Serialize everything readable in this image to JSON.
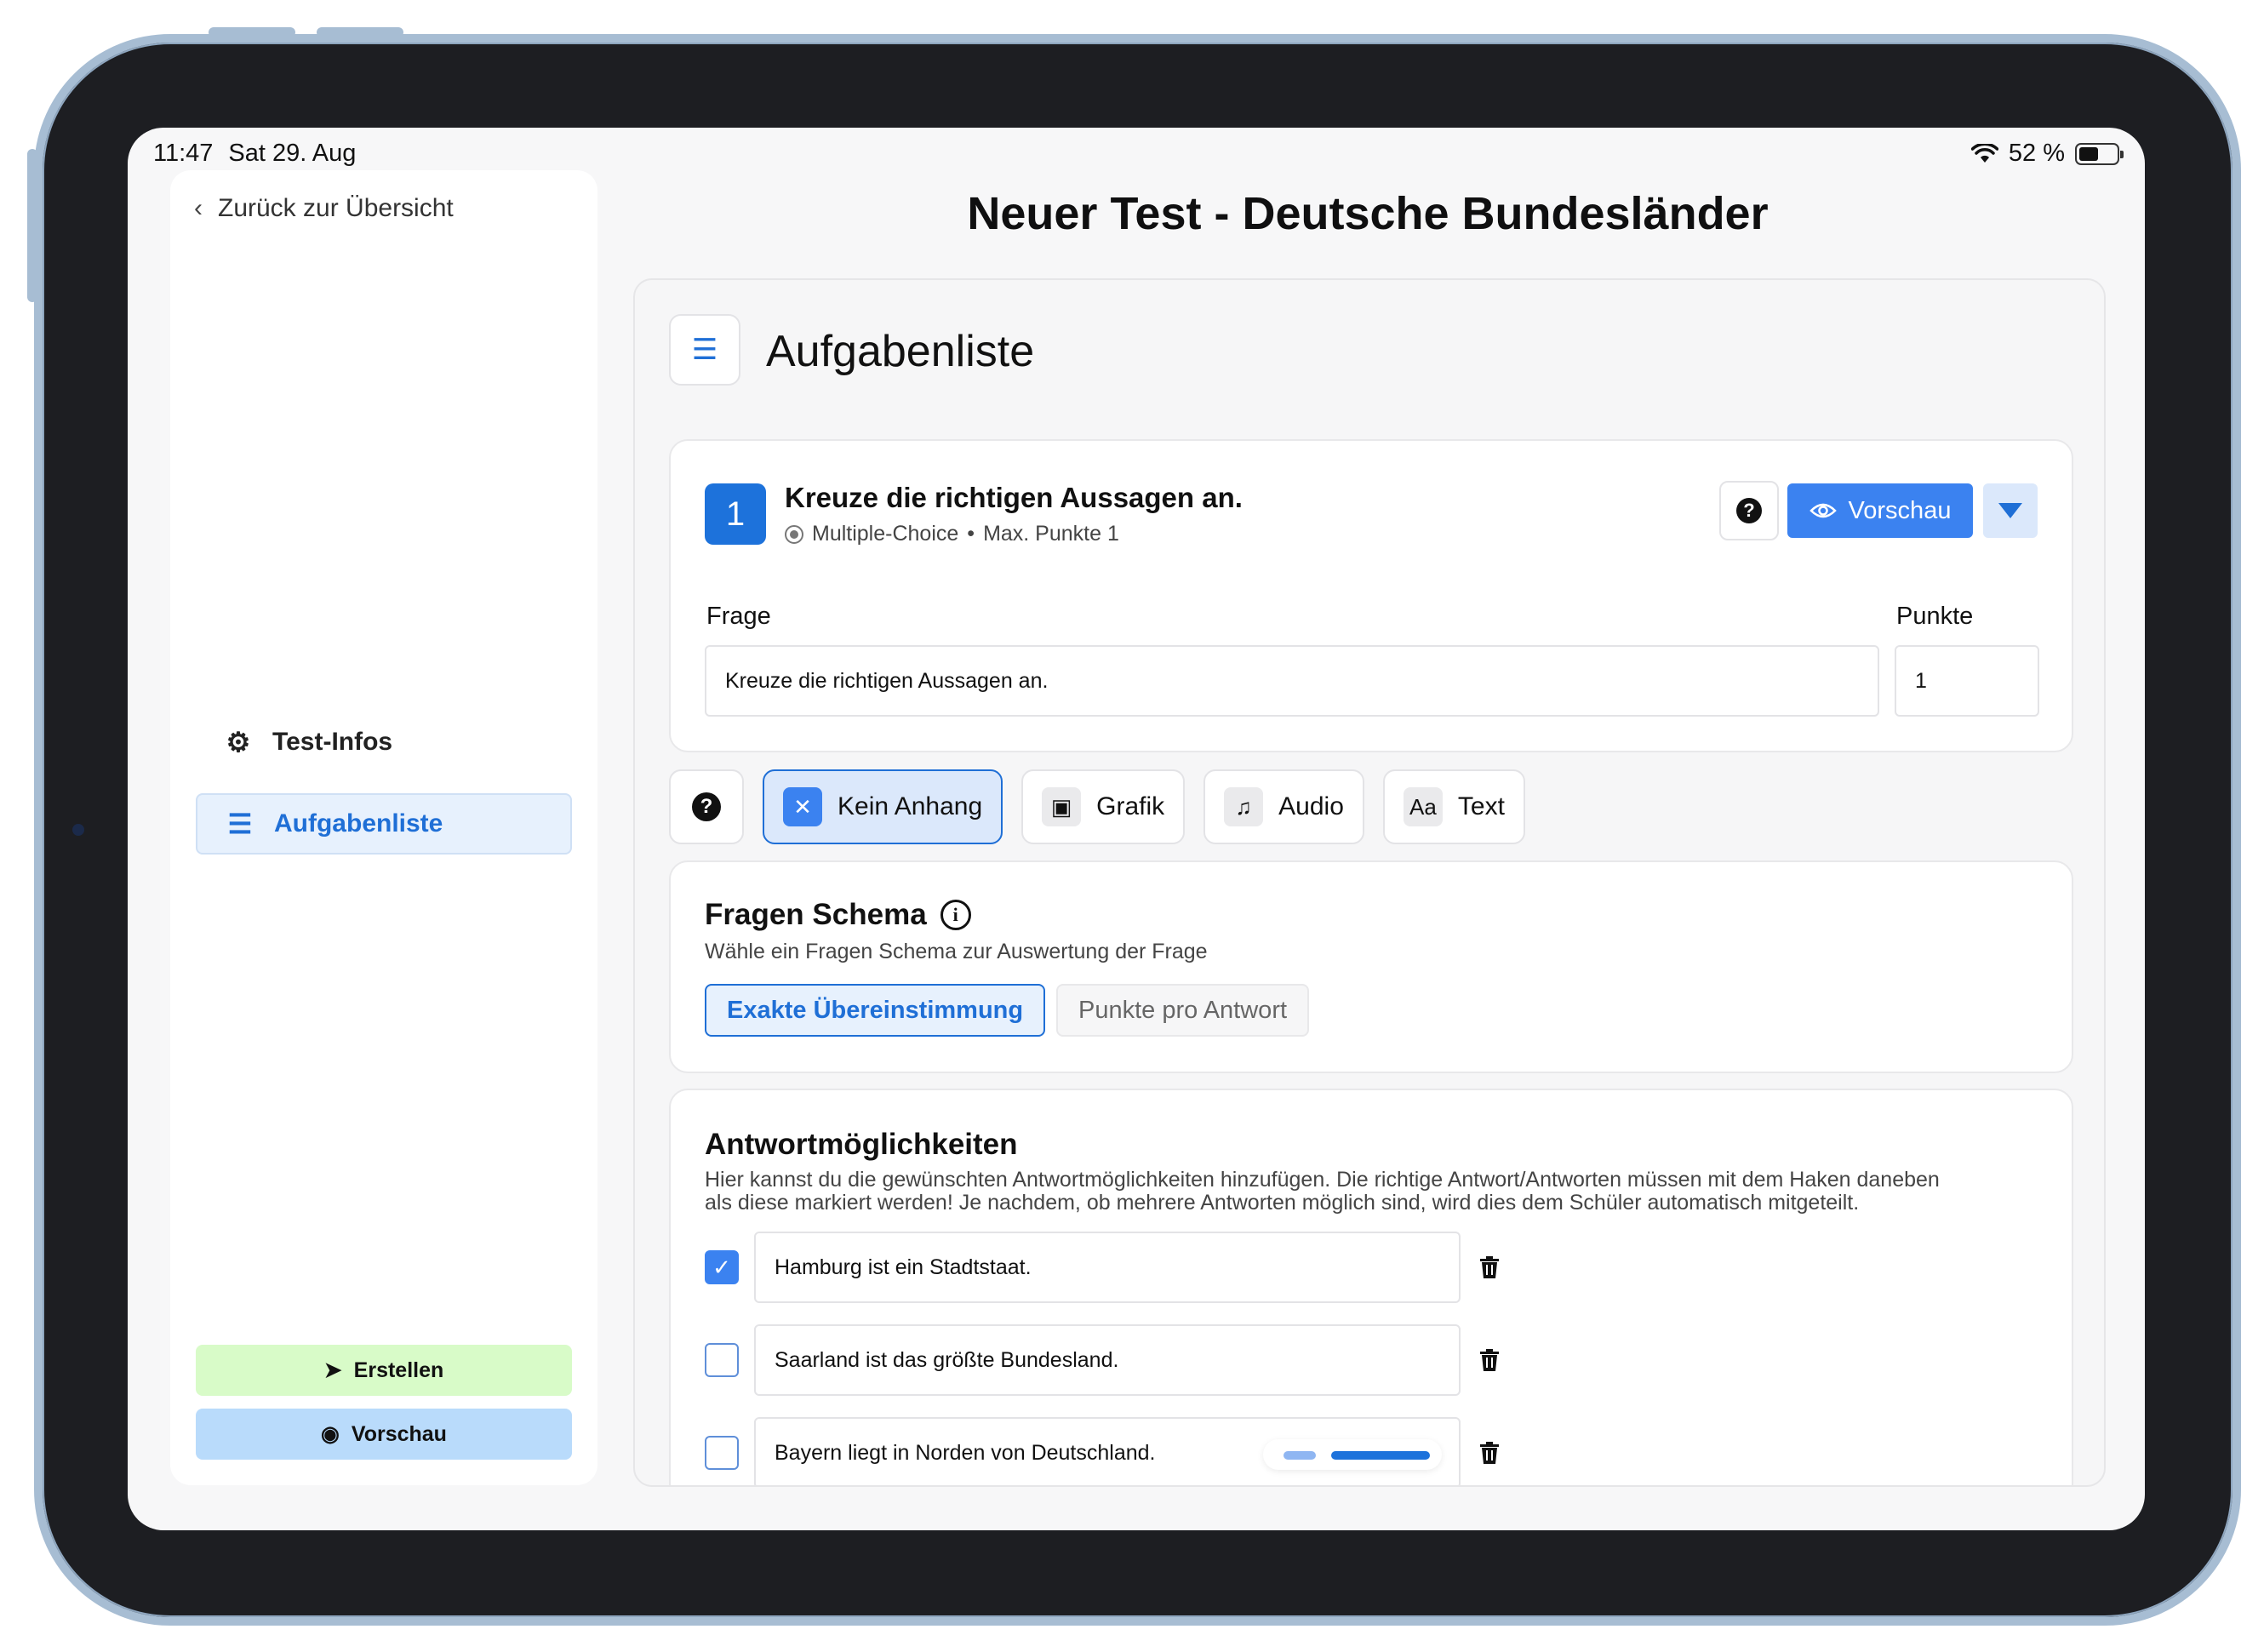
{
  "status_bar": {
    "time": "11:47",
    "date": "Sat 29. Aug",
    "battery": "52 %",
    "battery_level": 0.52
  },
  "sidebar": {
    "back_label": "Zurück zur Übersicht",
    "items": [
      {
        "label": "Test-Infos",
        "icon": "gear-icon",
        "active": false
      },
      {
        "label": "Aufgabenliste",
        "icon": "list-icon",
        "active": true
      }
    ],
    "create_label": "Erstellen",
    "preview_label": "Vorschau"
  },
  "page": {
    "title": "Neuer Test - Deutsche Bundesländer"
  },
  "task_list": {
    "title": "Aufgabenliste",
    "question": {
      "number": "1",
      "title": "Kreuze die richtigen Aussagen an.",
      "type": "Multiple-Choice",
      "separator": "•",
      "max_points": "Max. Punkte 1",
      "help_symbol": "?",
      "preview_label": "Vorschau",
      "question_label": "Frage",
      "question_value": "Kreuze die richtigen Aussagen an.",
      "points_label": "Punkte",
      "points_value": "1"
    },
    "attachments": [
      {
        "label": "Kein Anhang",
        "icon": "x-icon",
        "glyph": "✕",
        "selected": true
      },
      {
        "label": "Grafik",
        "icon": "image-icon",
        "glyph": "▣",
        "selected": false
      },
      {
        "label": "Audio",
        "icon": "music-note-icon",
        "glyph": "♫",
        "selected": false
      },
      {
        "label": "Text",
        "icon": "text-icon",
        "glyph": "Aa",
        "selected": false
      }
    ],
    "schema": {
      "title": "Fragen Schema",
      "subtitle": "Wähle ein Fragen Schema zur Auswertung der Frage",
      "options": [
        {
          "label": "Exakte Übereinstimmung",
          "active": true
        },
        {
          "label": "Punkte pro Antwort",
          "active": false
        }
      ]
    },
    "answers": {
      "title": "Antwortmöglichkeiten",
      "description_line1": "Hier kannst du die gewünschten Antwortmöglichkeiten hinzufügen. Die richtige Antwort/Antworten müssen mit dem Haken daneben",
      "description_line2": "als diese markiert werden! Je nachdem, ob mehrere Antworten möglich sind, wird dies dem Schüler automatisch mitgeteilt.",
      "items": [
        {
          "text": "Hamburg ist ein Stadtstaat.",
          "checked": true
        },
        {
          "text": "Saarland ist das größte Bundesland.",
          "checked": false
        },
        {
          "text": "Bayern liegt in Norden von Deutschland.",
          "checked": false
        }
      ]
    }
  },
  "colors": {
    "accent": "#1f6fd6",
    "primary_button": "#3b82f0",
    "create_button": "#d8fbc8",
    "preview_button": "#b9dbfb"
  }
}
